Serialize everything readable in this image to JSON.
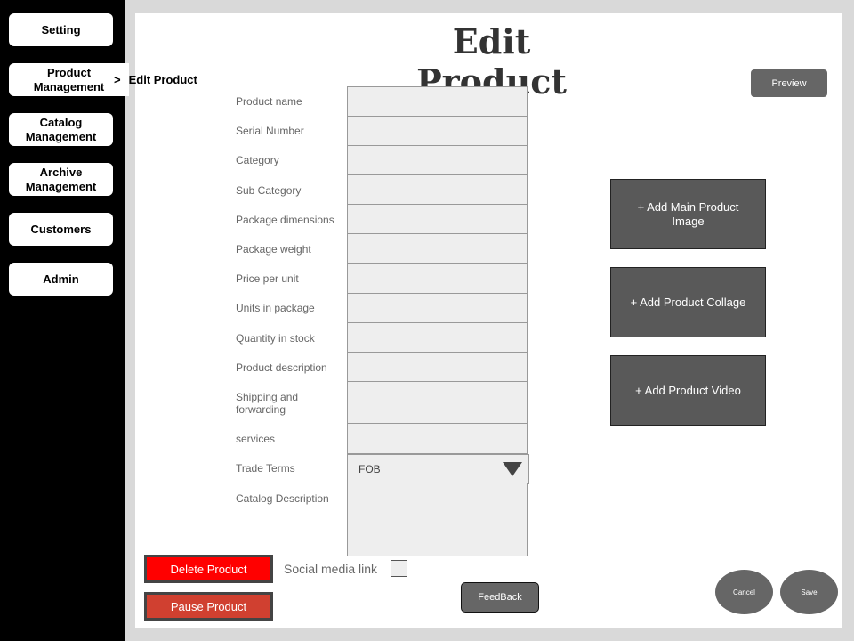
{
  "sidebar": {
    "items": [
      {
        "label": "Setting"
      },
      {
        "label": "Product Management"
      },
      {
        "label": "Catalog Management"
      },
      {
        "label": "Archive Management"
      },
      {
        "label": "Customers"
      },
      {
        "label": "Admin"
      }
    ]
  },
  "breadcrumb": {
    "separator": ">",
    "current": "Edit Product"
  },
  "page": {
    "title": "Edit Product"
  },
  "toolbar": {
    "preview_label": "Preview"
  },
  "form": {
    "fields": [
      {
        "label": "Product name",
        "value": ""
      },
      {
        "label": "Serial Number",
        "value": ""
      },
      {
        "label": "Category",
        "value": ""
      },
      {
        "label": "Sub Category",
        "value": ""
      },
      {
        "label": "Package dimensions",
        "value": ""
      },
      {
        "label": "Package weight",
        "value": ""
      },
      {
        "label": "Price per unit",
        "value": ""
      },
      {
        "label": "Units in package",
        "value": ""
      },
      {
        "label": "Quantity in stock",
        "value": ""
      },
      {
        "label": "Product description",
        "value": ""
      },
      {
        "label": "Shipping and forwarding",
        "value": ""
      },
      {
        "label": "services",
        "value": ""
      },
      {
        "label": "Trade Terms",
        "value": "FOB"
      },
      {
        "label": "Catalog Description",
        "value": ""
      }
    ]
  },
  "media": {
    "main_image_label": "+ Add Main  Product Image",
    "collage_label": "+ Add Product Collage",
    "video_label": "+ Add Product Video"
  },
  "actions": {
    "delete_label": "Delete Product",
    "pause_label": "Pause Product",
    "social_label": "Social media link",
    "social_checked": false,
    "feedback_label": "FeedBack",
    "cancel_label": "Cancel",
    "save_label": "Save"
  },
  "colors": {
    "sidebar_bg": "#000000",
    "delete": "#ff0000",
    "pause": "#d04030",
    "button_gray": "#595959",
    "input_bg": "#eeeeee"
  }
}
